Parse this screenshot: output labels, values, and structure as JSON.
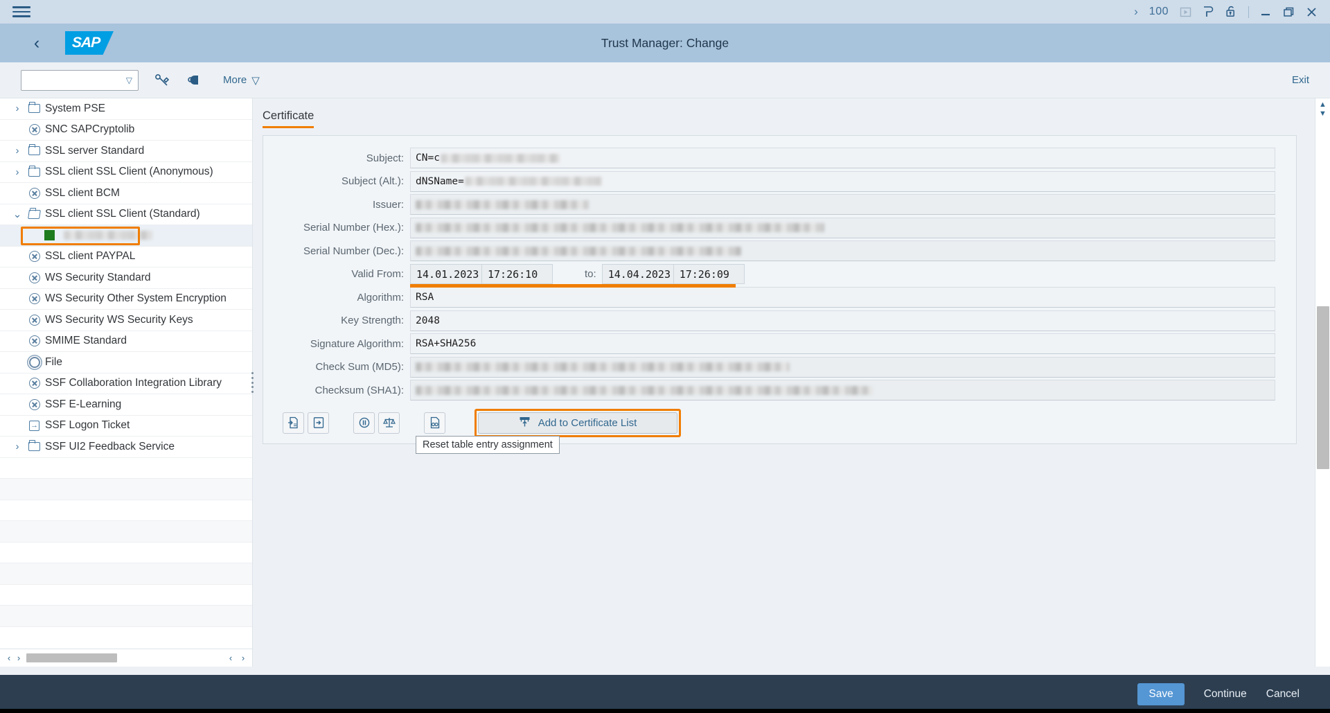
{
  "shell": {
    "menu_icon": "hamburger-menu-icon",
    "chevron_icon": "chevron-right-icon",
    "client_number": "100",
    "icons": [
      "play-button-icon",
      "sap-p-icon",
      "unlock-icon"
    ],
    "minimize": "minimize-icon",
    "restore": "restore-icon",
    "close": "close-icon"
  },
  "header": {
    "back": "back-arrow-icon",
    "logo_text": "SAP",
    "title": "Trust Manager: Change"
  },
  "toolbar": {
    "select_value": "",
    "select_caret": "chevron-down-icon",
    "edit_icon": "edit-pencil-icon",
    "key_icon": "key-lock-icon",
    "more_label": "More",
    "more_caret": "chevron-down-icon",
    "exit_label": "Exit"
  },
  "tree": {
    "items": [
      {
        "label": "System PSE",
        "icon": "folder-icon",
        "expander": "collapsed",
        "indent": 0
      },
      {
        "label": "SNC SAPCryptolib",
        "icon": "x-circle-icon",
        "expander": "none",
        "indent": 0
      },
      {
        "label": "SSL server Standard",
        "icon": "folder-icon",
        "expander": "collapsed",
        "indent": 0
      },
      {
        "label": "SSL client SSL Client (Anonymous)",
        "icon": "folder-icon",
        "expander": "collapsed",
        "indent": 0
      },
      {
        "label": "SSL client BCM",
        "icon": "x-circle-icon",
        "expander": "none",
        "indent": 0
      },
      {
        "label": "SSL client SSL Client (Standard)",
        "icon": "folder-open-icon",
        "expander": "expanded",
        "indent": 0
      },
      {
        "label": "",
        "icon": "green-square-icon",
        "expander": "none",
        "indent": 1,
        "redacted": true,
        "selected": true
      },
      {
        "label": "SSL client PAYPAL",
        "icon": "x-circle-icon",
        "expander": "none",
        "indent": 0
      },
      {
        "label": "WS Security Standard",
        "icon": "x-circle-icon",
        "expander": "none",
        "indent": 0
      },
      {
        "label": "WS Security Other System Encryption",
        "icon": "x-circle-icon",
        "expander": "none",
        "indent": 0
      },
      {
        "label": "WS Security WS Security Keys",
        "icon": "x-circle-icon",
        "expander": "none",
        "indent": 0
      },
      {
        "label": "SMIME Standard",
        "icon": "x-circle-icon",
        "expander": "none",
        "indent": 0
      },
      {
        "label": "File",
        "icon": "gear-icon",
        "expander": "none",
        "indent": 0
      },
      {
        "label": "SSF Collaboration Integration Library",
        "icon": "x-circle-icon",
        "expander": "none",
        "indent": 0
      },
      {
        "label": "SSF E-Learning",
        "icon": "x-circle-icon",
        "expander": "none",
        "indent": 0
      },
      {
        "label": "SSF Logon Ticket",
        "icon": "logon-ticket-icon",
        "expander": "none",
        "indent": 0
      },
      {
        "label": "SSF UI2 Feedback Service",
        "icon": "folder-icon",
        "expander": "collapsed",
        "indent": 0
      }
    ],
    "h_scroll": {
      "left_arrow": "chevron-left-icon",
      "right_arrow": "chevron-right-icon"
    }
  },
  "certificate": {
    "tab_label": "Certificate",
    "fields": [
      {
        "label": "Subject:",
        "value": "CN=c",
        "redacted": true,
        "editable": true
      },
      {
        "label": "Subject (Alt.):",
        "value": "dNSName=",
        "redacted": true,
        "editable": true
      },
      {
        "label": "Issuer:",
        "value": "",
        "redacted": true,
        "editable": false
      },
      {
        "label": "Serial Number (Hex.):",
        "value": "",
        "redacted": true,
        "editable": false
      },
      {
        "label": "Serial Number (Dec.):",
        "value": "",
        "redacted": true,
        "editable": false
      }
    ],
    "validity": {
      "label": "Valid From:",
      "from_date": "14.01.2023",
      "from_time": "17:26:10",
      "to_label": "to:",
      "to_date": "14.04.2023",
      "to_time": "17:26:09"
    },
    "fields2": [
      {
        "label": "Algorithm:",
        "value": "RSA",
        "redacted": false,
        "editable": true
      },
      {
        "label": "Key Strength:",
        "value": "2048",
        "redacted": false,
        "editable": true
      },
      {
        "label": "Signature Algorithm:",
        "value": "RSA+SHA256",
        "redacted": false,
        "editable": true
      },
      {
        "label": "Check Sum (MD5):",
        "value": "",
        "redacted": true,
        "editable": false
      },
      {
        "label": "Checksum (SHA1):",
        "value": "",
        "redacted": true,
        "editable": false
      }
    ],
    "actions": [
      {
        "name": "import-certificate-icon"
      },
      {
        "name": "export-certificate-icon"
      },
      {
        "name": "pause-circle-icon"
      },
      {
        "name": "balance-scales-icon"
      },
      {
        "name": "verify-certificate-icon"
      }
    ],
    "add_button": {
      "label": "Add to Certificate List",
      "icon": "add-to-list-icon"
    },
    "tooltip": "Reset table entry assignment"
  },
  "footer": {
    "save": "Save",
    "continue": "Continue",
    "cancel": "Cancel"
  },
  "colors": {
    "accent_orange": "#f07d00",
    "sap_blue": "#009ee3",
    "footer_dark": "#2c3e50",
    "save_blue": "#5596d4"
  }
}
